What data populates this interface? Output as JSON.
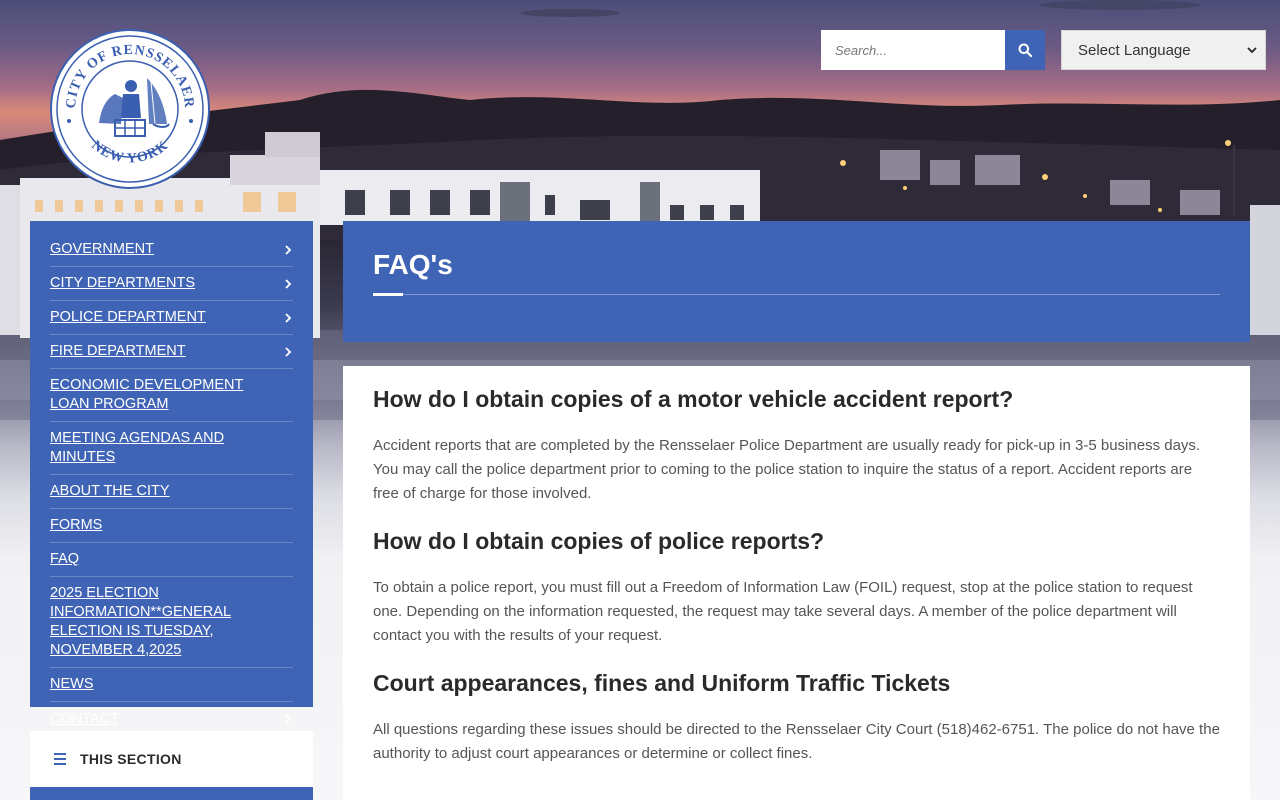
{
  "header": {
    "search_placeholder": "Search...",
    "language_label": "Select Language",
    "logo": {
      "top_text": "CITY OF RENSSELAER",
      "bottom_text": "NEW YORK"
    }
  },
  "nav": {
    "items": [
      {
        "label": "GOVERNMENT",
        "has_children": true
      },
      {
        "label": "CITY DEPARTMENTS",
        "has_children": true
      },
      {
        "label": "POLICE DEPARTMENT",
        "has_children": true
      },
      {
        "label": "FIRE DEPARTMENT",
        "has_children": true
      },
      {
        "label": "ECONOMIC DEVELOPMENT LOAN PROGRAM",
        "has_children": false
      },
      {
        "label": "MEETING AGENDAS AND MINUTES",
        "has_children": false
      },
      {
        "label": "ABOUT THE CITY",
        "has_children": false
      },
      {
        "label": "FORMS",
        "has_children": false
      },
      {
        "label": "FAQ",
        "has_children": false
      },
      {
        "label": "2025 ELECTION INFORMATION**GENERAL ELECTION IS TUESDAY, NOVEMBER 4,2025",
        "has_children": false
      },
      {
        "label": "NEWS",
        "has_children": false
      },
      {
        "label": "CONTACT",
        "has_children": true
      }
    ],
    "section_label": "THIS SECTION"
  },
  "page": {
    "title": "FAQ's",
    "faqs": [
      {
        "question": "How do I obtain copies of a motor vehicle accident report?",
        "answer": "Accident reports that are completed by the Rensselaer Police Department are usually ready for pick-up in 3-5 business days. You may call the police department prior to coming to the police station to inquire the status of a report. Accident reports are free of charge for those involved."
      },
      {
        "question": "How do I obtain copies of police reports?",
        "answer": "To obtain a police report, you must fill out a Freedom of Information Law (FOIL) request, stop at the police station to request one. Depending on the information requested, the request may take several days. A member of the police department will contact you with the results of your request."
      },
      {
        "question": "Court appearances, fines and Uniform Traffic Tickets",
        "answer": "All questions regarding these issues should be directed to the Rensselaer City Court (518)462-6751. The police do not have the authority to adjust court appearances or determine or collect fines."
      }
    ]
  },
  "colors": {
    "brand_blue": "#4064b5",
    "text_dark": "#2a2a2a",
    "text_body": "#555555"
  }
}
